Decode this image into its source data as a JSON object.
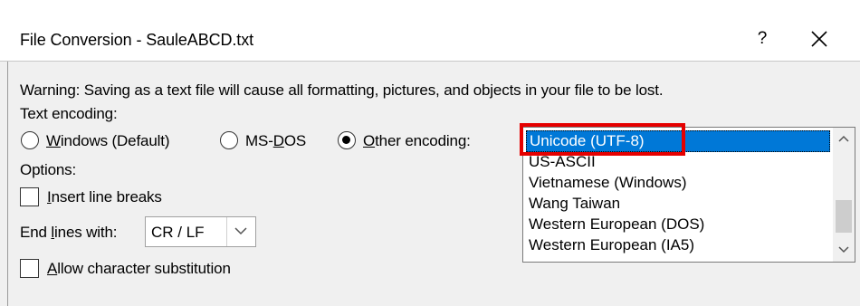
{
  "title": "File Conversion - SauleABCD.txt",
  "title_buttons": {
    "help": "?",
    "close": "×"
  },
  "warning": "Warning: Saving as a text file will cause all formatting, pictures, and objects in your file to be lost.",
  "text_encoding": {
    "label": "Text encoding:",
    "options": [
      {
        "mnemonic": "W",
        "rest": "indows (Default)",
        "selected": false
      },
      {
        "prefix": "MS-",
        "mnemonic": "D",
        "rest": "OS",
        "selected": false
      },
      {
        "mnemonic": "O",
        "rest": "ther encoding:",
        "selected": true
      }
    ]
  },
  "encoding_list": {
    "items": [
      "Unicode (UTF-8)",
      "US-ASCII",
      "Vietnamese (Windows)",
      "Wang Taiwan",
      "Western European (DOS)",
      "Western European (IA5)"
    ],
    "selected_index": 0
  },
  "options": {
    "label": "Options:",
    "insert_line_breaks": {
      "mnemonic": "I",
      "rest": "nsert line breaks",
      "checked": false
    },
    "end_lines_with": {
      "pre": "End ",
      "mnemonic": "l",
      "rest": "ines with:",
      "value": "CR / LF"
    },
    "allow_substitution": {
      "mnemonic": "A",
      "rest": "llow character substitution",
      "checked": false
    }
  },
  "colors": {
    "selection": "#0078d7",
    "annotation_box": "#e50000",
    "content_background": "#f0f0f0"
  },
  "icons": {
    "help": "question-mark-icon",
    "close": "close-icon",
    "dropdown": "chevron-down-icon",
    "scroll_up": "chevron-up-icon",
    "scroll_down": "chevron-down-icon"
  }
}
